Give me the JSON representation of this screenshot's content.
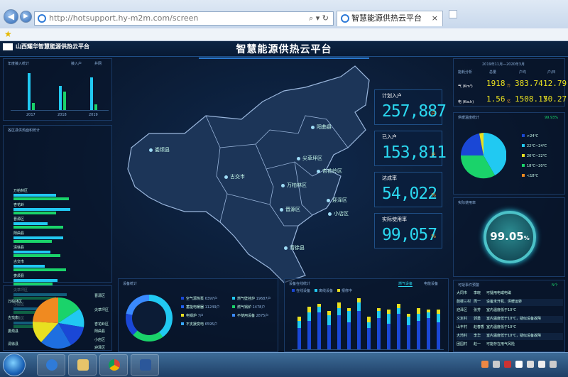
{
  "browser": {
    "url": "http://hotsupport.hy-m2m.com/screen",
    "tab_title": "智慧能源供热云平台",
    "back_icon": "◀",
    "forward_icon": "▶"
  },
  "dashboard": {
    "brand": "山西耀华智慧能源供热云平台",
    "title": "智慧能源供热云平台",
    "left_top": {
      "title": "年度接入统计",
      "legend": [
        "接入户",
        "并网"
      ],
      "years": [
        "2017",
        "2018",
        "2019"
      ]
    },
    "left_mid": {
      "title": "各区县供热面积统计",
      "items": [
        "万柏林区",
        "杏花岭",
        "晋源区",
        "阳曲县",
        "清徐县",
        "古交市",
        "娄烦县",
        "尖草坪区",
        "小店区",
        "迎泽区"
      ]
    },
    "left_bottom": {
      "labels_left": [
        "万柏林区",
        "古交市",
        "娄烦县",
        "清徐县"
      ],
      "labels_right": [
        "晋源区",
        "尖草坪区",
        "杏花岭区",
        "阳曲县",
        "小店区",
        "迎泽区"
      ]
    },
    "map_labels": [
      "阳曲县",
      "娄烦县",
      "古交市",
      "尖草坪区",
      "杏花岭区",
      "万柏林区",
      "迎泽区",
      "晋源区",
      "小店区",
      "清徐县"
    ],
    "stats": [
      {
        "label": "计划入户",
        "value": "257,887",
        "unit": "户"
      },
      {
        "label": "已入户",
        "value": "153,811",
        "unit": "户"
      },
      {
        "label": "达成率",
        "value": "54,022",
        "unit": "%"
      },
      {
        "label": "实际使用率",
        "value": "99,057",
        "unit": "%"
      }
    ],
    "right_top": {
      "title": "能耗分析",
      "period": "2019年11月—2020年3月",
      "headers": [
        "总量",
        "户均",
        "户/日"
      ],
      "rows": [
        {
          "label": "气 (Km³)",
          "total": "1918",
          "unit": "万",
          "avg": "383.74",
          "day": "12.79"
        },
        {
          "label": "电 (Kw.h)",
          "total": "1.56",
          "unit": "亿",
          "avg": "1508.17",
          "day": "50.27"
        }
      ]
    },
    "temp": {
      "title": "供暖温度统计",
      "percent": "99.93%",
      "legend": [
        ">24℃",
        "22℃~24℃",
        "20℃~22℃",
        "18℃~20℃",
        "<18℃"
      ]
    },
    "gauge": {
      "title": "实际使用率",
      "value": "99.05",
      "unit": "%"
    },
    "devices": {
      "title": "设备统计",
      "items": [
        {
          "name": "空气源热泵",
          "val": "6397户",
          "color": "#1a47d6"
        },
        {
          "name": "燃气壁挂炉",
          "val": "19687户",
          "color": "#21c9f2"
        },
        {
          "name": "蓄能电暖器",
          "val": "11249户",
          "color": "#2060f0"
        },
        {
          "name": "燃气锅炉",
          "val": "1478户",
          "color": "#1ad36a"
        },
        {
          "name": "电锅炉",
          "val": "7户",
          "color": "#e8e020"
        },
        {
          "name": "不使用设备",
          "val": "2875户",
          "color": "#3a8aff"
        },
        {
          "name": "不支援变电",
          "val": "6595户",
          "color": "#38a8ff"
        }
      ]
    },
    "online": {
      "title": "设备在线统计",
      "tabs": [
        "燃气设备",
        "电能设备"
      ],
      "legend": [
        "在线设备",
        "离线设备",
        "报修中"
      ]
    },
    "alarms": {
      "title": "可疑事件预警",
      "count": "N个",
      "rows": [
        {
          "area": "大同市",
          "name": "李晓",
          "msg": "可疑用电或电磁"
        },
        {
          "area": "鼓楼三村",
          "name": "周一",
          "msg": "设备未开机、供暖运转"
        },
        {
          "area": "迎泽区",
          "name": "张芳",
          "msg": "室内温度低于10℃"
        },
        {
          "area": "义定村",
          "name": "郭勇",
          "msg": "室内温度低于10℃，疑似设备故障"
        },
        {
          "area": "山丰村",
          "name": "赵春香",
          "msg": "室内温度低于10℃"
        },
        {
          "area": "大湾村",
          "name": "李华",
          "msg": "室内温度低于10℃，疑似设备故障"
        },
        {
          "area": "团园村",
          "name": "赵一",
          "msg": "可能存在用气风险"
        }
      ]
    }
  },
  "colors": {
    "accent": "#2bd8f0",
    "orange": "#f0a030",
    "green": "#1ad36a",
    "blue": "#1a47d6"
  }
}
